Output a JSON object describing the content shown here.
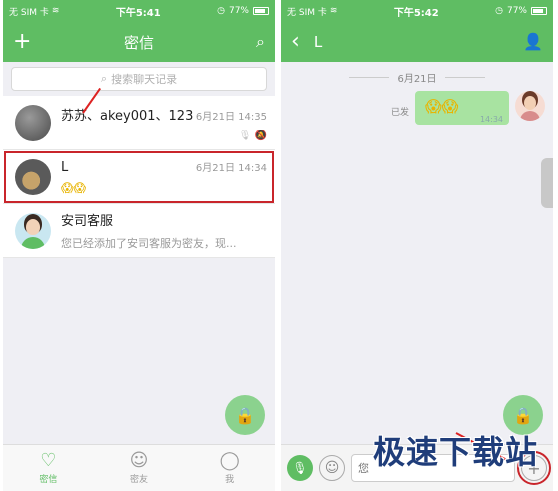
{
  "left_phone": {
    "status": {
      "carrier": "无 SIM 卡",
      "time": "下午5:41",
      "battery": "77%"
    },
    "nav": {
      "title": "密信",
      "add_icon": "plus-icon",
      "search_icon": "search-icon"
    },
    "search": {
      "placeholder": "搜索聊天记录"
    },
    "chats": [
      {
        "name": "苏苏、akey001、123",
        "time": "6月21日 14:35",
        "preview": ""
      },
      {
        "name": "L",
        "time": "6月21日 14:34",
        "preview": "😱😱"
      },
      {
        "name": "安司客服",
        "time": "",
        "preview": "您已经添加了安司客服为密友，现..."
      }
    ],
    "tabs": [
      {
        "label": "密信",
        "icon": "chat-icon"
      },
      {
        "label": "密友",
        "icon": "contacts-icon"
      },
      {
        "label": "我",
        "icon": "me-icon"
      }
    ]
  },
  "right_phone": {
    "status": {
      "carrier": "无 SIM 卡",
      "time": "下午5:42",
      "battery": "77%"
    },
    "nav": {
      "title": "L",
      "back_icon": "back-icon",
      "profile_icon": "profile-icon"
    },
    "date_divider": "6月21日",
    "message": {
      "status": "已发",
      "content": "😱😱",
      "time": "14:34"
    },
    "input": {
      "placeholder": "您"
    }
  },
  "watermark": "极速下载站"
}
